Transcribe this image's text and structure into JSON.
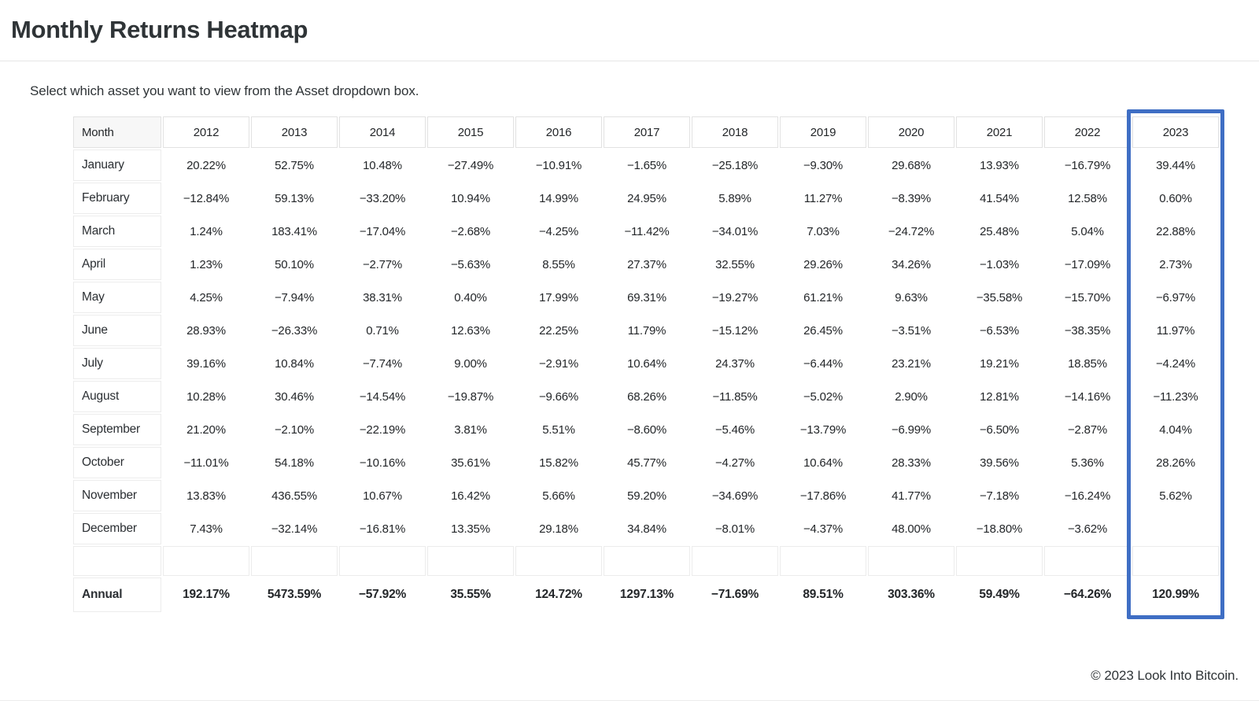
{
  "header": {
    "title": "Monthly Returns Heatmap"
  },
  "intro": {
    "text": "Select which asset you want to view from the Asset dropdown box."
  },
  "footer": {
    "copyright": "© 2023 Look Into Bitcoin."
  },
  "highlight": {
    "column": "2023",
    "color": "#3f6ec4"
  },
  "colors": {
    "positive": "#a8e6c1",
    "negative": "#f98c8c",
    "neutral": "#fdda8e",
    "blank": "#ffffff",
    "accent": "#3f6ec4",
    "text": "#232629"
  },
  "chart_data": {
    "type": "heatmap",
    "title": "Monthly Returns Heatmap",
    "xlabel": "",
    "ylabel": "Month",
    "legend": [],
    "grid": true,
    "columns": [
      "Month",
      "2012",
      "2013",
      "2014",
      "2015",
      "2016",
      "2017",
      "2018",
      "2019",
      "2020",
      "2021",
      "2022",
      "2023"
    ],
    "categories": [
      "2012",
      "2013",
      "2014",
      "2015",
      "2016",
      "2017",
      "2018",
      "2019",
      "2020",
      "2021",
      "2022",
      "2023"
    ],
    "rows": [
      {
        "month": "January",
        "cells": [
          {
            "text": "20.22%",
            "v": 20.22,
            "c": "pos"
          },
          {
            "text": "52.75%",
            "v": 52.75,
            "c": "pos"
          },
          {
            "text": "10.48%",
            "v": 10.48,
            "c": "pos"
          },
          {
            "text": "−27.49%",
            "v": -27.49,
            "c": "neg"
          },
          {
            "text": "−10.91%",
            "v": -10.91,
            "c": "neg"
          },
          {
            "text": "−1.65%",
            "v": -1.65,
            "c": "neu"
          },
          {
            "text": "−25.18%",
            "v": -25.18,
            "c": "neg"
          },
          {
            "text": "−9.30%",
            "v": -9.3,
            "c": "neg"
          },
          {
            "text": "29.68%",
            "v": 29.68,
            "c": "pos"
          },
          {
            "text": "13.93%",
            "v": 13.93,
            "c": "pos"
          },
          {
            "text": "−16.79%",
            "v": -16.79,
            "c": "neg"
          },
          {
            "text": "39.44%",
            "v": 39.44,
            "c": "pos"
          }
        ]
      },
      {
        "month": "February",
        "cells": [
          {
            "text": "−12.84%",
            "v": -12.84,
            "c": "neg"
          },
          {
            "text": "59.13%",
            "v": 59.13,
            "c": "pos"
          },
          {
            "text": "−33.20%",
            "v": -33.2,
            "c": "neg"
          },
          {
            "text": "10.94%",
            "v": 10.94,
            "c": "pos"
          },
          {
            "text": "14.99%",
            "v": 14.99,
            "c": "pos"
          },
          {
            "text": "24.95%",
            "v": 24.95,
            "c": "pos"
          },
          {
            "text": "5.89%",
            "v": 5.89,
            "c": "pos"
          },
          {
            "text": "11.27%",
            "v": 11.27,
            "c": "pos"
          },
          {
            "text": "−8.39%",
            "v": -8.39,
            "c": "neg"
          },
          {
            "text": "41.54%",
            "v": 41.54,
            "c": "pos"
          },
          {
            "text": "12.58%",
            "v": 12.58,
            "c": "pos"
          },
          {
            "text": "0.60%",
            "v": 0.6,
            "c": "neu"
          }
        ]
      },
      {
        "month": "March",
        "cells": [
          {
            "text": "1.24%",
            "v": 1.24,
            "c": "neu"
          },
          {
            "text": "183.41%",
            "v": 183.41,
            "c": "pos"
          },
          {
            "text": "−17.04%",
            "v": -17.04,
            "c": "neg"
          },
          {
            "text": "−2.68%",
            "v": -2.68,
            "c": "neu"
          },
          {
            "text": "−4.25%",
            "v": -4.25,
            "c": "neg"
          },
          {
            "text": "−11.42%",
            "v": -11.42,
            "c": "neg"
          },
          {
            "text": "−34.01%",
            "v": -34.01,
            "c": "neg"
          },
          {
            "text": "7.03%",
            "v": 7.03,
            "c": "pos"
          },
          {
            "text": "−24.72%",
            "v": -24.72,
            "c": "neg"
          },
          {
            "text": "25.48%",
            "v": 25.48,
            "c": "pos"
          },
          {
            "text": "5.04%",
            "v": 5.04,
            "c": "pos"
          },
          {
            "text": "22.88%",
            "v": 22.88,
            "c": "pos"
          }
        ]
      },
      {
        "month": "April",
        "cells": [
          {
            "text": "1.23%",
            "v": 1.23,
            "c": "neu"
          },
          {
            "text": "50.10%",
            "v": 50.1,
            "c": "pos"
          },
          {
            "text": "−2.77%",
            "v": -2.77,
            "c": "neu"
          },
          {
            "text": "−5.63%",
            "v": -5.63,
            "c": "neg"
          },
          {
            "text": "8.55%",
            "v": 8.55,
            "c": "pos"
          },
          {
            "text": "27.37%",
            "v": 27.37,
            "c": "pos"
          },
          {
            "text": "32.55%",
            "v": 32.55,
            "c": "pos"
          },
          {
            "text": "29.26%",
            "v": 29.26,
            "c": "pos"
          },
          {
            "text": "34.26%",
            "v": 34.26,
            "c": "pos"
          },
          {
            "text": "−1.03%",
            "v": -1.03,
            "c": "neu"
          },
          {
            "text": "−17.09%",
            "v": -17.09,
            "c": "neg"
          },
          {
            "text": "2.73%",
            "v": 2.73,
            "c": "neu"
          }
        ]
      },
      {
        "month": "May",
        "cells": [
          {
            "text": "4.25%",
            "v": 4.25,
            "c": "pos"
          },
          {
            "text": "−7.94%",
            "v": -7.94,
            "c": "neg"
          },
          {
            "text": "38.31%",
            "v": 38.31,
            "c": "pos"
          },
          {
            "text": "0.40%",
            "v": 0.4,
            "c": "neu"
          },
          {
            "text": "17.99%",
            "v": 17.99,
            "c": "pos"
          },
          {
            "text": "69.31%",
            "v": 69.31,
            "c": "pos"
          },
          {
            "text": "−19.27%",
            "v": -19.27,
            "c": "neg"
          },
          {
            "text": "61.21%",
            "v": 61.21,
            "c": "pos"
          },
          {
            "text": "9.63%",
            "v": 9.63,
            "c": "pos"
          },
          {
            "text": "−35.58%",
            "v": -35.58,
            "c": "neg"
          },
          {
            "text": "−15.70%",
            "v": -15.7,
            "c": "neg"
          },
          {
            "text": "−6.97%",
            "v": -6.97,
            "c": "neg"
          }
        ]
      },
      {
        "month": "June",
        "cells": [
          {
            "text": "28.93%",
            "v": 28.93,
            "c": "pos"
          },
          {
            "text": "−26.33%",
            "v": -26.33,
            "c": "neg"
          },
          {
            "text": "0.71%",
            "v": 0.71,
            "c": "neu"
          },
          {
            "text": "12.63%",
            "v": 12.63,
            "c": "pos"
          },
          {
            "text": "22.25%",
            "v": 22.25,
            "c": "pos"
          },
          {
            "text": "11.79%",
            "v": 11.79,
            "c": "pos"
          },
          {
            "text": "−15.12%",
            "v": -15.12,
            "c": "neg"
          },
          {
            "text": "26.45%",
            "v": 26.45,
            "c": "pos"
          },
          {
            "text": "−3.51%",
            "v": -3.51,
            "c": "neg"
          },
          {
            "text": "−6.53%",
            "v": -6.53,
            "c": "neg"
          },
          {
            "text": "−38.35%",
            "v": -38.35,
            "c": "neg"
          },
          {
            "text": "11.97%",
            "v": 11.97,
            "c": "pos"
          }
        ]
      },
      {
        "month": "July",
        "cells": [
          {
            "text": "39.16%",
            "v": 39.16,
            "c": "pos"
          },
          {
            "text": "10.84%",
            "v": 10.84,
            "c": "pos"
          },
          {
            "text": "−7.74%",
            "v": -7.74,
            "c": "neg"
          },
          {
            "text": "9.00%",
            "v": 9.0,
            "c": "pos"
          },
          {
            "text": "−2.91%",
            "v": -2.91,
            "c": "neu"
          },
          {
            "text": "10.64%",
            "v": 10.64,
            "c": "pos"
          },
          {
            "text": "24.37%",
            "v": 24.37,
            "c": "pos"
          },
          {
            "text": "−6.44%",
            "v": -6.44,
            "c": "neg"
          },
          {
            "text": "23.21%",
            "v": 23.21,
            "c": "pos"
          },
          {
            "text": "19.21%",
            "v": 19.21,
            "c": "pos"
          },
          {
            "text": "18.85%",
            "v": 18.85,
            "c": "pos"
          },
          {
            "text": "−4.24%",
            "v": -4.24,
            "c": "neg"
          }
        ]
      },
      {
        "month": "August",
        "cells": [
          {
            "text": "10.28%",
            "v": 10.28,
            "c": "pos"
          },
          {
            "text": "30.46%",
            "v": 30.46,
            "c": "pos"
          },
          {
            "text": "−14.54%",
            "v": -14.54,
            "c": "neg"
          },
          {
            "text": "−19.87%",
            "v": -19.87,
            "c": "neg"
          },
          {
            "text": "−9.66%",
            "v": -9.66,
            "c": "neg"
          },
          {
            "text": "68.26%",
            "v": 68.26,
            "c": "pos"
          },
          {
            "text": "−11.85%",
            "v": -11.85,
            "c": "neg"
          },
          {
            "text": "−5.02%",
            "v": -5.02,
            "c": "neg"
          },
          {
            "text": "2.90%",
            "v": 2.9,
            "c": "neu"
          },
          {
            "text": "12.81%",
            "v": 12.81,
            "c": "pos"
          },
          {
            "text": "−14.16%",
            "v": -14.16,
            "c": "neg"
          },
          {
            "text": "−11.23%",
            "v": -11.23,
            "c": "neg"
          }
        ]
      },
      {
        "month": "September",
        "cells": [
          {
            "text": "21.20%",
            "v": 21.2,
            "c": "pos"
          },
          {
            "text": "−2.10%",
            "v": -2.1,
            "c": "neu"
          },
          {
            "text": "−22.19%",
            "v": -22.19,
            "c": "neg"
          },
          {
            "text": "3.81%",
            "v": 3.81,
            "c": "pos"
          },
          {
            "text": "5.51%",
            "v": 5.51,
            "c": "pos"
          },
          {
            "text": "−8.60%",
            "v": -8.6,
            "c": "neg"
          },
          {
            "text": "−5.46%",
            "v": -5.46,
            "c": "neg"
          },
          {
            "text": "−13.79%",
            "v": -13.79,
            "c": "neg"
          },
          {
            "text": "−6.99%",
            "v": -6.99,
            "c": "neg"
          },
          {
            "text": "−6.50%",
            "v": -6.5,
            "c": "neg"
          },
          {
            "text": "−2.87%",
            "v": -2.87,
            "c": "neu"
          },
          {
            "text": "4.04%",
            "v": 4.04,
            "c": "pos"
          }
        ]
      },
      {
        "month": "October",
        "cells": [
          {
            "text": "−11.01%",
            "v": -11.01,
            "c": "neg"
          },
          {
            "text": "54.18%",
            "v": 54.18,
            "c": "pos"
          },
          {
            "text": "−10.16%",
            "v": -10.16,
            "c": "neg"
          },
          {
            "text": "35.61%",
            "v": 35.61,
            "c": "pos"
          },
          {
            "text": "15.82%",
            "v": 15.82,
            "c": "pos"
          },
          {
            "text": "45.77%",
            "v": 45.77,
            "c": "pos"
          },
          {
            "text": "−4.27%",
            "v": -4.27,
            "c": "neg"
          },
          {
            "text": "10.64%",
            "v": 10.64,
            "c": "pos"
          },
          {
            "text": "28.33%",
            "v": 28.33,
            "c": "pos"
          },
          {
            "text": "39.56%",
            "v": 39.56,
            "c": "pos"
          },
          {
            "text": "5.36%",
            "v": 5.36,
            "c": "pos"
          },
          {
            "text": "28.26%",
            "v": 28.26,
            "c": "pos"
          }
        ]
      },
      {
        "month": "November",
        "cells": [
          {
            "text": "13.83%",
            "v": 13.83,
            "c": "pos"
          },
          {
            "text": "436.55%",
            "v": 436.55,
            "c": "pos"
          },
          {
            "text": "10.67%",
            "v": 10.67,
            "c": "pos"
          },
          {
            "text": "16.42%",
            "v": 16.42,
            "c": "pos"
          },
          {
            "text": "5.66%",
            "v": 5.66,
            "c": "pos"
          },
          {
            "text": "59.20%",
            "v": 59.2,
            "c": "pos"
          },
          {
            "text": "−34.69%",
            "v": -34.69,
            "c": "neg"
          },
          {
            "text": "−17.86%",
            "v": -17.86,
            "c": "neg"
          },
          {
            "text": "41.77%",
            "v": 41.77,
            "c": "pos"
          },
          {
            "text": "−7.18%",
            "v": -7.18,
            "c": "neg"
          },
          {
            "text": "−16.24%",
            "v": -16.24,
            "c": "neg"
          },
          {
            "text": "5.62%",
            "v": 5.62,
            "c": "pos"
          }
        ]
      },
      {
        "month": "December",
        "cells": [
          {
            "text": "7.43%",
            "v": 7.43,
            "c": "pos"
          },
          {
            "text": "−32.14%",
            "v": -32.14,
            "c": "neg"
          },
          {
            "text": "−16.81%",
            "v": -16.81,
            "c": "neg"
          },
          {
            "text": "13.35%",
            "v": 13.35,
            "c": "pos"
          },
          {
            "text": "29.18%",
            "v": 29.18,
            "c": "pos"
          },
          {
            "text": "34.84%",
            "v": 34.84,
            "c": "pos"
          },
          {
            "text": "−8.01%",
            "v": -8.01,
            "c": "neg"
          },
          {
            "text": "−4.37%",
            "v": -4.37,
            "c": "neg"
          },
          {
            "text": "48.00%",
            "v": 48.0,
            "c": "pos"
          },
          {
            "text": "−18.80%",
            "v": -18.8,
            "c": "neg"
          },
          {
            "text": "−3.62%",
            "v": -3.62,
            "c": "neg"
          },
          {
            "text": "",
            "v": null,
            "c": "blank"
          }
        ]
      }
    ],
    "spacer_row": {
      "month": "",
      "cells": [
        {
          "text": "",
          "v": null,
          "c": "blank"
        },
        {
          "text": "",
          "v": null,
          "c": "blank"
        },
        {
          "text": "",
          "v": null,
          "c": "blank"
        },
        {
          "text": "",
          "v": null,
          "c": "blank"
        },
        {
          "text": "",
          "v": null,
          "c": "blank"
        },
        {
          "text": "",
          "v": null,
          "c": "blank"
        },
        {
          "text": "",
          "v": null,
          "c": "blank"
        },
        {
          "text": "",
          "v": null,
          "c": "blank"
        },
        {
          "text": "",
          "v": null,
          "c": "blank"
        },
        {
          "text": "",
          "v": null,
          "c": "blank"
        },
        {
          "text": "",
          "v": null,
          "c": "blank"
        },
        {
          "text": "",
          "v": null,
          "c": "blank"
        }
      ]
    },
    "annual_row": {
      "month": "Annual",
      "cells": [
        {
          "text": "192.17%",
          "v": 192.17,
          "c": "pos"
        },
        {
          "text": "5473.59%",
          "v": 5473.59,
          "c": "pos"
        },
        {
          "text": "−57.92%",
          "v": -57.92,
          "c": "neg"
        },
        {
          "text": "35.55%",
          "v": 35.55,
          "c": "pos"
        },
        {
          "text": "124.72%",
          "v": 124.72,
          "c": "pos"
        },
        {
          "text": "1297.13%",
          "v": 1297.13,
          "c": "pos"
        },
        {
          "text": "−71.69%",
          "v": -71.69,
          "c": "neg"
        },
        {
          "text": "89.51%",
          "v": 89.51,
          "c": "pos"
        },
        {
          "text": "303.36%",
          "v": 303.36,
          "c": "pos"
        },
        {
          "text": "59.49%",
          "v": 59.49,
          "c": "pos"
        },
        {
          "text": "−64.26%",
          "v": -64.26,
          "c": "neg"
        },
        {
          "text": "120.99%",
          "v": 120.99,
          "c": "pos"
        }
      ]
    }
  }
}
